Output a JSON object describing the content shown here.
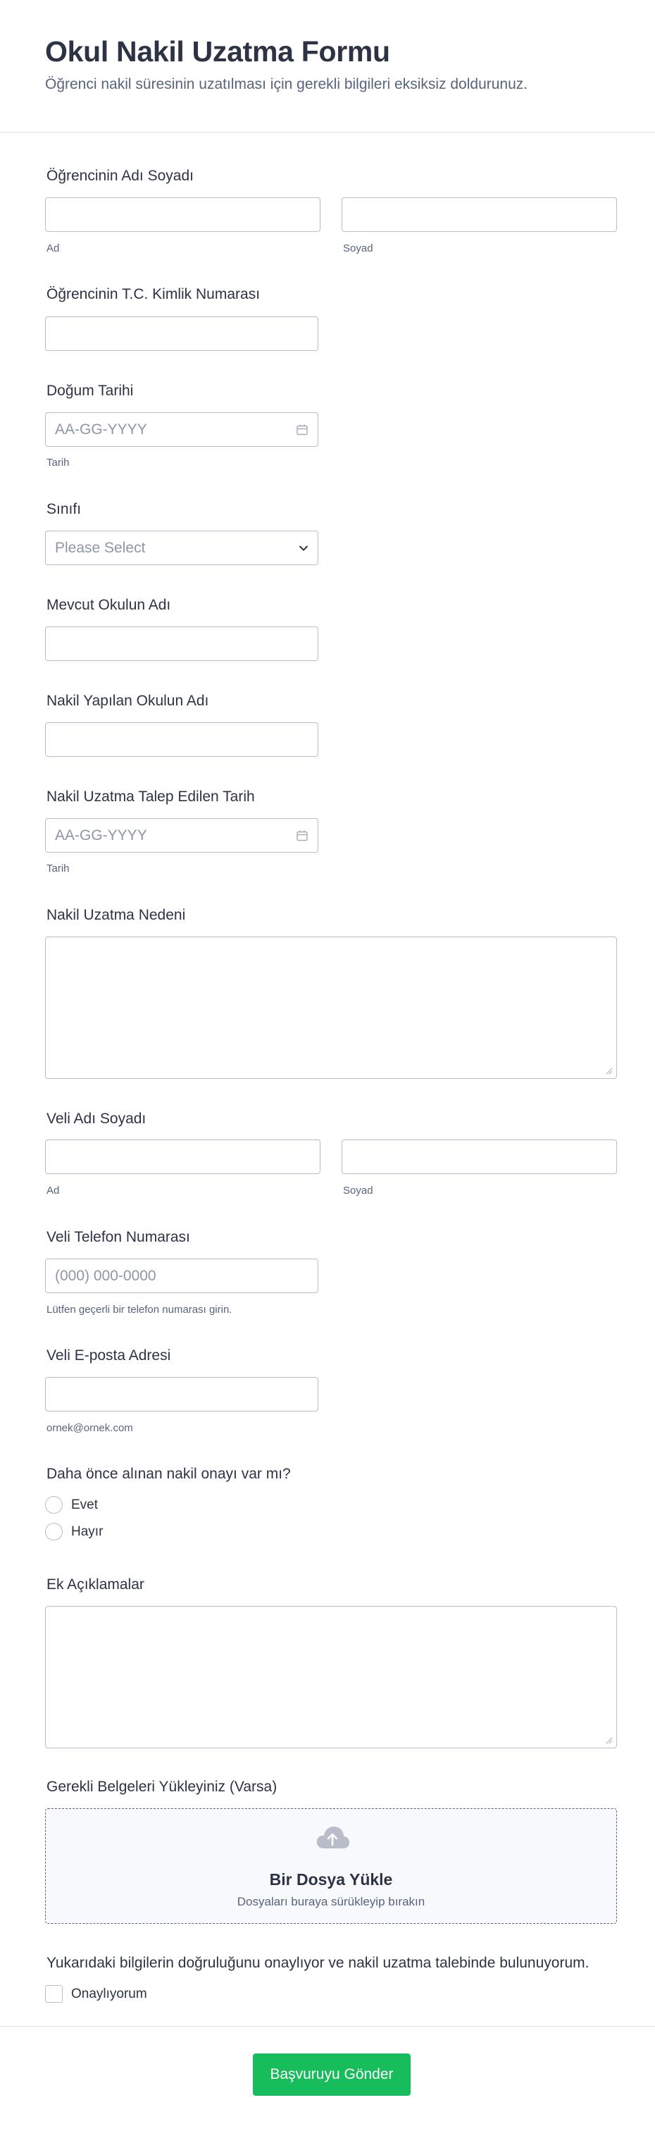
{
  "header": {
    "title": "Okul Nakil Uzatma Formu",
    "subtitle": "Öğrenci nakil süresinin uzatılması için gerekli bilgileri eksiksiz doldurunuz."
  },
  "fields": {
    "student_name": {
      "label": "Öğrencinin Adı Soyadı",
      "first_sublabel": "Ad",
      "last_sublabel": "Soyad",
      "first_value": "",
      "last_value": ""
    },
    "student_tc": {
      "label": "Öğrencinin T.C. Kimlik Numarası",
      "value": ""
    },
    "birth_date": {
      "label": "Doğum Tarihi",
      "placeholder": "AA-GG-YYYY",
      "sublabel": "Tarih",
      "icon": "calendar-icon"
    },
    "grade": {
      "label": "Sınıfı",
      "placeholder": "Please Select",
      "icon": "chevron-down-icon"
    },
    "current_school": {
      "label": "Mevcut Okulun Adı",
      "value": ""
    },
    "transfer_school": {
      "label": "Nakil Yapılan Okulun Adı",
      "value": ""
    },
    "extension_date": {
      "label": "Nakil Uzatma Talep Edilen Tarih",
      "placeholder": "AA-GG-YYYY",
      "sublabel": "Tarih",
      "icon": "calendar-icon"
    },
    "extension_reason": {
      "label": "Nakil Uzatma Nedeni",
      "value": ""
    },
    "parent_name": {
      "label": "Veli Adı Soyadı",
      "first_sublabel": "Ad",
      "last_sublabel": "Soyad",
      "first_value": "",
      "last_value": ""
    },
    "parent_phone": {
      "label": "Veli Telefon Numarası",
      "placeholder": "(000) 000-0000",
      "sublabel": "Lütfen geçerli bir telefon numarası girin."
    },
    "parent_email": {
      "label": "Veli E-posta Adresi",
      "sublabel": "ornek@ornek.com",
      "value": ""
    },
    "prior_approval": {
      "label": "Daha önce alınan nakil onayı var mı?",
      "options": [
        "Evet",
        "Hayır"
      ]
    },
    "additional_notes": {
      "label": "Ek Açıklamalar",
      "value": ""
    },
    "documents": {
      "label": "Gerekli Belgeleri Yükleyiniz (Varsa)",
      "upload_title": "Bir Dosya Yükle",
      "upload_sub": "Dosyaları buraya sürükleyip bırakın",
      "icon": "cloud-upload-icon"
    },
    "confirmation": {
      "label": "Yukarıdaki bilgilerin doğruluğunu onaylıyor ve nakil uzatma talebinde bulunuyorum.",
      "option": "Onaylıyorum"
    }
  },
  "submit": {
    "label": "Başvuruyu Gönder",
    "color": "#18bd5b"
  }
}
